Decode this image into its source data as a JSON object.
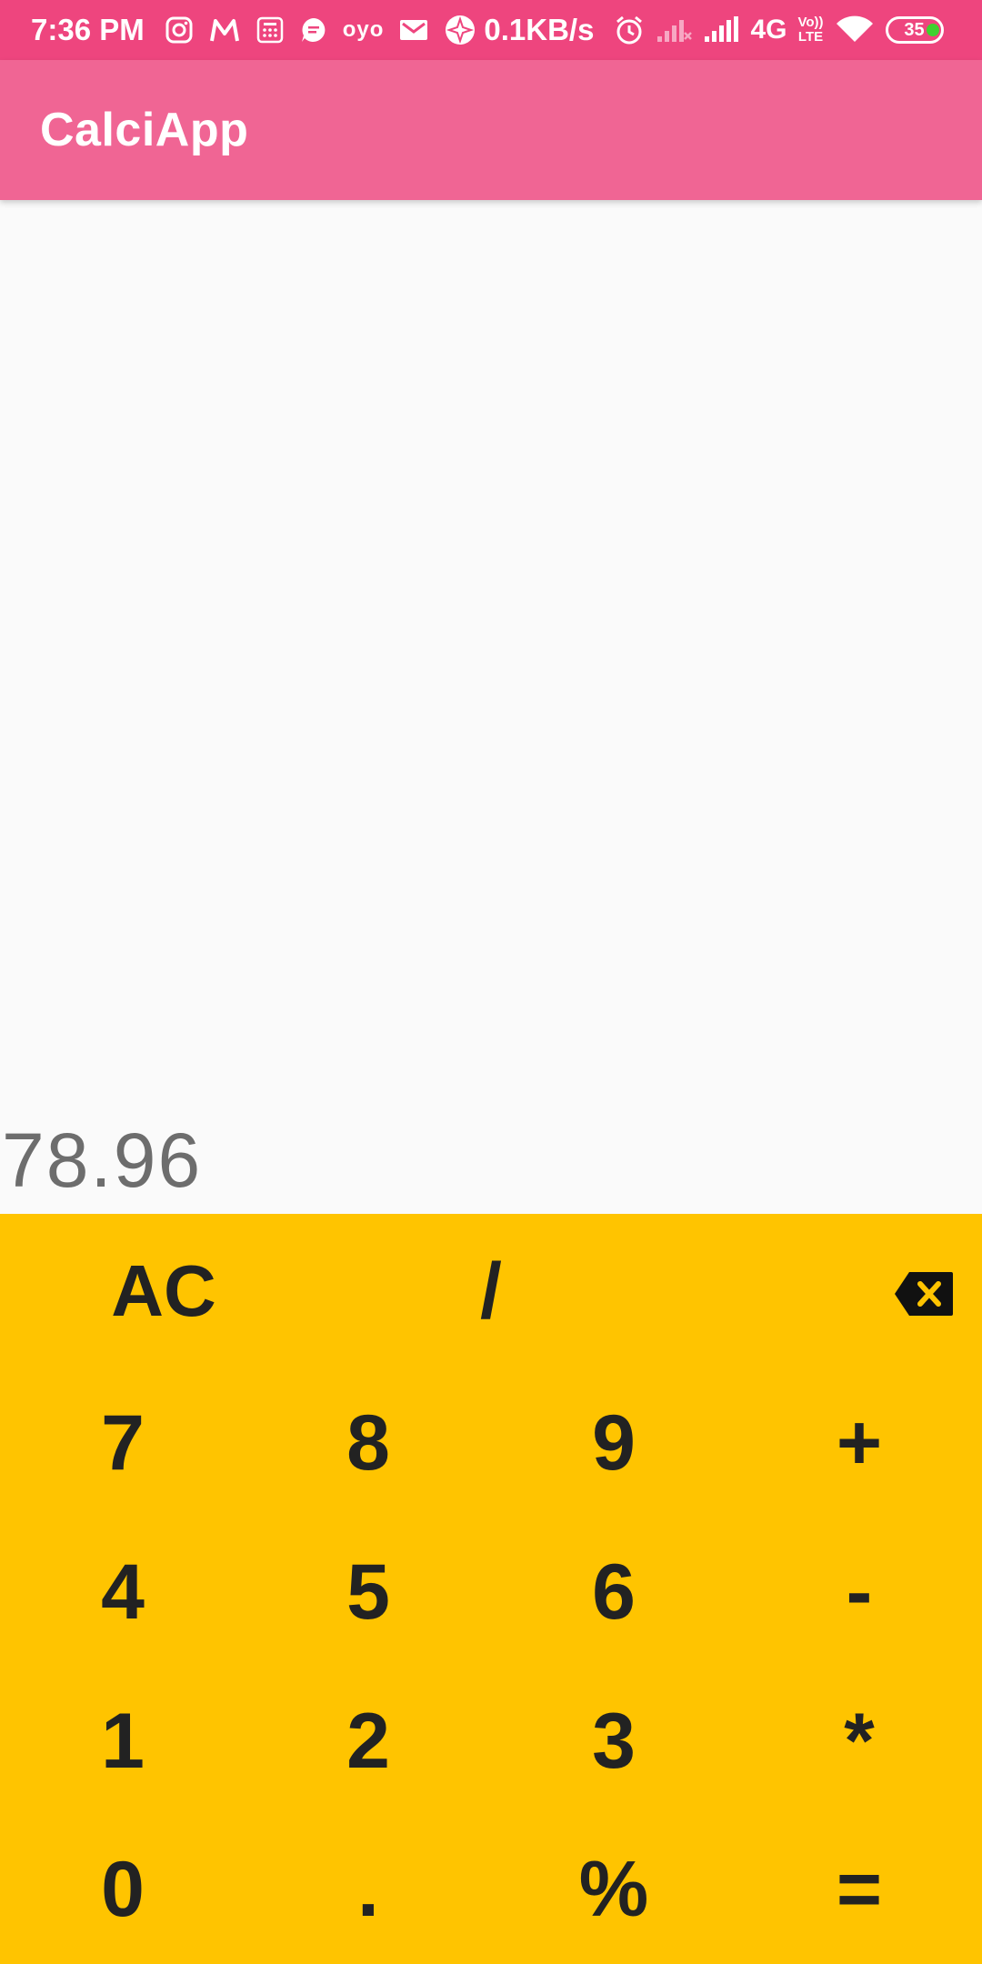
{
  "status_bar": {
    "time": "7:36 PM",
    "speed": "0.1KB/s",
    "network": "4G",
    "volte_top": "Vo))",
    "volte_bottom": "LTE",
    "battery": "35",
    "icons": [
      "instagram-icon",
      "myntra-icon",
      "calculator-icon",
      "message-icon",
      "oyo-icon",
      "gmail-icon",
      "vpn-icon",
      "alarm-icon",
      "signal-icon",
      "signal-icon",
      "wifi-icon",
      "battery-icon"
    ],
    "oyo": "oyo",
    "colors": {
      "background": "#ee457e"
    }
  },
  "app_bar": {
    "title": "CalciApp",
    "color": "#f06594"
  },
  "display": {
    "value": "78.96",
    "color": "#6d6d6d"
  },
  "keypad": {
    "background": "#ffc400",
    "row0": {
      "clear": "AC",
      "divide": "/",
      "backspace_icon": "backspace-icon"
    },
    "row1": [
      "7",
      "8",
      "9",
      "+"
    ],
    "row2": [
      "4",
      "5",
      "6",
      "-"
    ],
    "row3": [
      "1",
      "2",
      "3",
      "*"
    ],
    "row4": [
      "0",
      ".",
      "%",
      "="
    ]
  }
}
